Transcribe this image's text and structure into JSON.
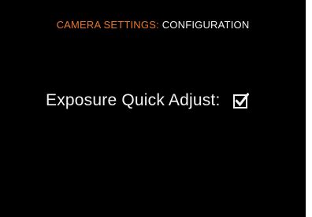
{
  "header": {
    "section": "CAMERA SETTINGS:",
    "page": "CONFIGURATION"
  },
  "setting": {
    "label": "Exposure Quick Adjust:",
    "checked": true
  },
  "colors": {
    "background": "#000000",
    "accent": "#e8742a",
    "text": "#f2f2f2"
  },
  "icons": {
    "checkbox": "checkbox-checked-icon"
  }
}
